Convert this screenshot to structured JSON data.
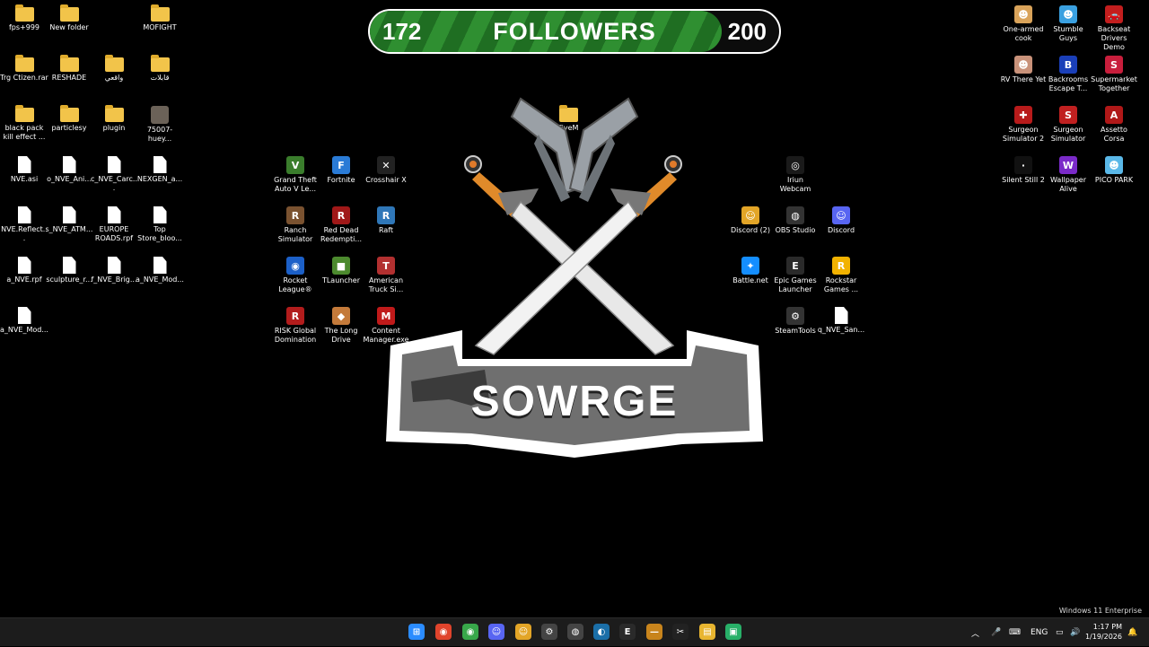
{
  "desktop": {
    "icons": [
      {
        "label": "fps+999",
        "type": "folder"
      },
      {
        "label": "New folder",
        "type": "folder"
      },
      {
        "label": "MOFIGHT",
        "type": "folder"
      },
      {
        "label": "Trg Ctizen.rar",
        "type": "folder"
      },
      {
        "label": "RESHADE",
        "type": "folder"
      },
      {
        "label": "واقعي",
        "type": "folder"
      },
      {
        "label": "قابلات",
        "type": "folder"
      },
      {
        "label": "black pack kill effect ...",
        "type": "folder"
      },
      {
        "label": "particlesy",
        "type": "folder"
      },
      {
        "label": "plugin",
        "type": "folder"
      },
      {
        "label": "75007-huey...",
        "type": "image"
      },
      {
        "label": "NVE.asi",
        "type": "file"
      },
      {
        "label": "o_NVE_Ani...",
        "type": "file"
      },
      {
        "label": "c_NVE_Carc...",
        "type": "file"
      },
      {
        "label": "NEXGEN_a...",
        "type": "file"
      },
      {
        "label": "NVE.Reflect...",
        "type": "file"
      },
      {
        "label": "s_NVE_ATM...",
        "type": "file"
      },
      {
        "label": "EUROPE ROADS.rpf",
        "type": "file"
      },
      {
        "label": "Top Store_bloo...",
        "type": "file"
      },
      {
        "label": "a_NVE.rpf",
        "type": "file"
      },
      {
        "label": "sculpture_r...",
        "type": "file"
      },
      {
        "label": "f_NVE_Brig...",
        "type": "file"
      },
      {
        "label": "a_NVE_Mod...",
        "type": "file"
      },
      {
        "label": "a_NVE_Mod...",
        "type": "file"
      },
      {
        "label": "FiveM",
        "type": "folder"
      },
      {
        "label": "Grand Theft Auto V Le...",
        "type": "app",
        "color": "#3a7d2c",
        "glyph": "V"
      },
      {
        "label": "Fortnite",
        "type": "app",
        "color": "#2a7bd6",
        "glyph": "F"
      },
      {
        "label": "Crosshair X",
        "type": "app",
        "color": "#222222",
        "glyph": "✕"
      },
      {
        "label": "Ranch Simulator",
        "type": "app",
        "color": "#7a5230",
        "glyph": "R"
      },
      {
        "label": "Red Dead Redempti...",
        "type": "app",
        "color": "#a01818",
        "glyph": "R"
      },
      {
        "label": "Raft",
        "type": "app",
        "color": "#2f77b8",
        "glyph": "R"
      },
      {
        "label": "Rocket League®",
        "type": "app",
        "color": "#1c60c8",
        "glyph": "◉"
      },
      {
        "label": "TLauncher",
        "type": "app",
        "color": "#4c8a2e",
        "glyph": "■"
      },
      {
        "label": "American Truck Si...",
        "type": "app",
        "color": "#b23030",
        "glyph": "T"
      },
      {
        "label": "RISK Global Domination",
        "type": "app",
        "color": "#b21c1c",
        "glyph": "R"
      },
      {
        "label": "The Long Drive",
        "type": "app",
        "color": "#c47a3a",
        "glyph": "◆"
      },
      {
        "label": "Content Manager.exe",
        "type": "app",
        "color": "#c01a1a",
        "glyph": "M"
      },
      {
        "label": "Iriun Webcam",
        "type": "app",
        "color": "#1a1a1a",
        "glyph": "◎"
      },
      {
        "label": "Discord (2)",
        "type": "app",
        "color": "#e3a527",
        "glyph": "☺"
      },
      {
        "label": "OBS Studio",
        "type": "app",
        "color": "#333333",
        "glyph": "◍"
      },
      {
        "label": "Discord",
        "type": "app",
        "color": "#5865f2",
        "glyph": "☺"
      },
      {
        "label": "Battle.net",
        "type": "app",
        "color": "#148eff",
        "glyph": "✦"
      },
      {
        "label": "Epic Games Launcher",
        "type": "app",
        "color": "#2a2a2a",
        "glyph": "E"
      },
      {
        "label": "Rockstar Games ...",
        "type": "app",
        "color": "#f2b200",
        "glyph": "R"
      },
      {
        "label": "SteamTools",
        "type": "app",
        "color": "#333333",
        "glyph": "⚙"
      },
      {
        "label": "q_NVE_San...",
        "type": "file"
      },
      {
        "label": "One-armed cook",
        "type": "app",
        "color": "#d9a35a",
        "glyph": "☻"
      },
      {
        "label": "Stumble Guys",
        "type": "app",
        "color": "#3aa0e0",
        "glyph": "☻"
      },
      {
        "label": "Backseat Drivers Demo",
        "type": "app",
        "color": "#c21e1e",
        "glyph": "🚗"
      },
      {
        "label": "RV There Yet",
        "type": "app",
        "color": "#c9927a",
        "glyph": "☻"
      },
      {
        "label": "Backrooms Escape T...",
        "type": "app",
        "color": "#1a3fb8",
        "glyph": "B"
      },
      {
        "label": "Supermarket Together",
        "type": "app",
        "color": "#c81e3c",
        "glyph": "S"
      },
      {
        "label": "Surgeon Simulator 2",
        "type": "app",
        "color": "#b81b1b",
        "glyph": "✚"
      },
      {
        "label": "Surgeon Simulator",
        "type": "app",
        "color": "#c02020",
        "glyph": "S"
      },
      {
        "label": "Assetto Corsa",
        "type": "app",
        "color": "#b01818",
        "glyph": "A"
      },
      {
        "label": "Silent Still 2",
        "type": "app",
        "color": "#111111",
        "glyph": "·"
      },
      {
        "label": "Wallpaper Alive",
        "type": "app",
        "color": "#7a2ac8",
        "glyph": "W"
      },
      {
        "label": "PICO PARK",
        "type": "app",
        "color": "#5ab8e8",
        "glyph": "☻"
      }
    ]
  },
  "overlay": {
    "followers_current": "172",
    "followers_title": "FOLLOWERS",
    "followers_goal": "200",
    "progress_fraction": 0.86,
    "logo_text": "SOWRGE"
  },
  "watermark": "Windows 11 Enterprise",
  "taskbar": {
    "apps": [
      {
        "name": "start",
        "glyph": "⊞",
        "color": "#2b8cff"
      },
      {
        "name": "chrome",
        "glyph": "◉",
        "color": "#e0442c"
      },
      {
        "name": "chrome-2",
        "glyph": "◉",
        "color": "#38a84a"
      },
      {
        "name": "discord",
        "glyph": "☺",
        "color": "#5865f2"
      },
      {
        "name": "discord-2",
        "glyph": "☺",
        "color": "#e3a527"
      },
      {
        "name": "steam-tools",
        "glyph": "⚙",
        "color": "#444444"
      },
      {
        "name": "obs",
        "glyph": "◍",
        "color": "#444444"
      },
      {
        "name": "steam",
        "glyph": "◐",
        "color": "#1b6fa8"
      },
      {
        "name": "epic",
        "glyph": "E",
        "color": "#2a2a2a"
      },
      {
        "name": "app-line",
        "glyph": "—",
        "color": "#c8841c"
      },
      {
        "name": "capcut",
        "glyph": "✂",
        "color": "#222222"
      },
      {
        "name": "file-explorer",
        "glyph": "▤",
        "color": "#e8b530"
      },
      {
        "name": "app-green",
        "glyph": "▣",
        "color": "#28b068"
      }
    ],
    "lang": "ENG",
    "time": "1:17 PM",
    "date": "1/19/2026"
  }
}
